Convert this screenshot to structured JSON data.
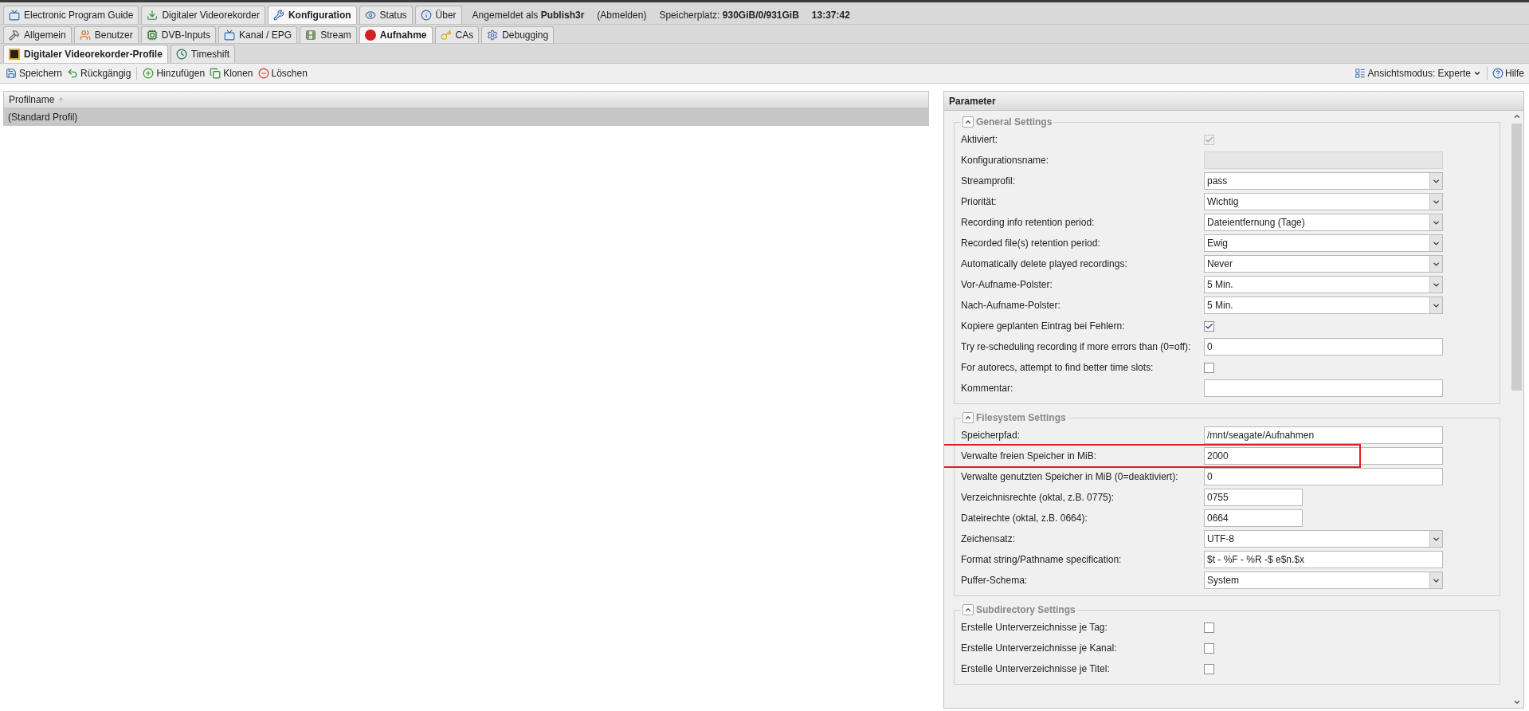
{
  "main_tabs": [
    {
      "label": "Electronic Program Guide",
      "selected": false
    },
    {
      "label": "Digitaler Videorekorder",
      "selected": false
    },
    {
      "label": "Konfiguration",
      "selected": true
    },
    {
      "label": "Status",
      "selected": false
    },
    {
      "label": "Über",
      "selected": false
    }
  ],
  "session": {
    "user": "Angemeldet als **Publish3r**",
    "logout": "(Abmelden)",
    "storage": "Speicherplatz: **930GiB/0/931GiB**",
    "time": "13:37:42"
  },
  "config_tabs": [
    {
      "label": "Allgemein",
      "selected": false
    },
    {
      "label": "Benutzer",
      "selected": false
    },
    {
      "label": "DVB-Inputs",
      "selected": false
    },
    {
      "label": "Kanal / EPG",
      "selected": false
    },
    {
      "label": "Stream",
      "selected": false
    },
    {
      "label": "Aufnahme",
      "selected": true
    },
    {
      "label": "CAs",
      "selected": false
    },
    {
      "label": "Debugging",
      "selected": false
    }
  ],
  "sub_tabs": [
    {
      "label": "Digitaler Videorekorder-Profile",
      "selected": true
    },
    {
      "label": "Timeshift",
      "selected": false
    }
  ],
  "toolbar": {
    "left": [
      "Speichern",
      "Rückgängig",
      "Hinzufügen",
      "Klonen",
      "Löschen"
    ],
    "view_mode": "Ansichtsmodus: Experte",
    "help": "Hilfe"
  },
  "table": {
    "columns": [
      {
        "label": "Profilname"
      }
    ],
    "rows": [
      {
        "cells": [
          "(Standard Profil)"
        ],
        "selected": true
      }
    ]
  },
  "parameter_panel": {
    "title": "Parameter",
    "sections": [
      {
        "title": "General Settings",
        "expanded": true,
        "fields": [
          {
            "label": "Aktiviert:",
            "kind": "checkbox",
            "checked": true,
            "disabled": true,
            "highlighted": false
          },
          {
            "label": "Konfigurationsname:",
            "kind": "text",
            "short": false,
            "disabled": true,
            "highlighted": false
          },
          {
            "label": "Streamprofil:",
            "kind": "select",
            "value": "pass",
            "disabled": false,
            "highlighted": false
          },
          {
            "label": "Priorität:",
            "kind": "select",
            "value": "Wichtig",
            "disabled": false,
            "highlighted": false
          },
          {
            "label": "Recording info retention period:",
            "kind": "select",
            "value": "Dateientfernung (Tage)",
            "disabled": false,
            "highlighted": false
          },
          {
            "label": "Recorded file(s) retention period:",
            "kind": "select",
            "value": "Ewig",
            "disabled": false,
            "highlighted": false
          },
          {
            "label": "Automatically delete played recordings:",
            "kind": "select",
            "value": "Never",
            "disabled": false,
            "highlighted": false
          },
          {
            "label": "Vor-Aufname-Polster:",
            "kind": "select",
            "value": "5 Min.",
            "disabled": false,
            "highlighted": false
          },
          {
            "label": "Nach-Aufname-Polster:",
            "kind": "select",
            "value": "5 Min.",
            "disabled": false,
            "highlighted": false
          },
          {
            "label": "Kopiere geplanten Eintrag bei Fehlern:",
            "kind": "checkbox",
            "checked": true,
            "disabled": false,
            "highlighted": false
          },
          {
            "label": "Try re-scheduling recording if more errors than (0=off):",
            "kind": "text",
            "value": "0",
            "short": false,
            "disabled": false,
            "highlighted": false
          },
          {
            "label": "For autorecs, attempt to find better time slots:",
            "kind": "checkbox",
            "checked": false,
            "disabled": false,
            "highlighted": false
          },
          {
            "label": "Kommentar:",
            "kind": "text",
            "short": false,
            "disabled": false,
            "highlighted": false
          }
        ]
      },
      {
        "title": "Filesystem Settings",
        "expanded": true,
        "fields": [
          {
            "label": "Speicherpfad:",
            "kind": "text",
            "value": "/mnt/seagate/Aufnahmen",
            "short": false,
            "disabled": false,
            "highlighted": false
          },
          {
            "label": "Verwalte freien Speicher in MiB:",
            "kind": "text",
            "value": "2000",
            "short": false,
            "disabled": false,
            "highlighted": true
          },
          {
            "label": "Verwalte genutzten Speicher in MiB (0=deaktiviert):",
            "kind": "text",
            "value": "0",
            "short": false,
            "disabled": false,
            "highlighted": false
          },
          {
            "label": "Verzeichnisrechte (oktal, z.B. 0775):",
            "kind": "text",
            "value": "0755",
            "short": true,
            "disabled": false,
            "highlighted": false
          },
          {
            "label": "Dateirechte (oktal, z.B. 0664):",
            "kind": "text",
            "value": "0664",
            "short": true,
            "disabled": false,
            "highlighted": false
          },
          {
            "label": "Zeichensatz:",
            "kind": "select",
            "value": "UTF-8",
            "disabled": false,
            "highlighted": false
          },
          {
            "label": "Format string/Pathname specification:",
            "kind": "text",
            "value": "$t - %F - %R -$ e$n.$x",
            "short": false,
            "disabled": false,
            "highlighted": false
          },
          {
            "label": "Puffer-Schema:",
            "kind": "select",
            "value": "System",
            "disabled": false,
            "highlighted": false
          }
        ]
      },
      {
        "title": "Subdirectory Settings",
        "expanded": true,
        "fields": [
          {
            "label": "Erstelle Unterverzeichnisse je Tag:",
            "kind": "checkbox",
            "checked": false,
            "disabled": false,
            "highlighted": false
          },
          {
            "label": "Erstelle Unterverzeichnisse je Kanal:",
            "kind": "checkbox",
            "checked": false,
            "disabled": false,
            "highlighted": false
          },
          {
            "label": "Erstelle Unterverzeichnisse je Titel:",
            "kind": "checkbox",
            "checked": false,
            "disabled": false,
            "highlighted": false
          }
        ]
      }
    ]
  }
}
